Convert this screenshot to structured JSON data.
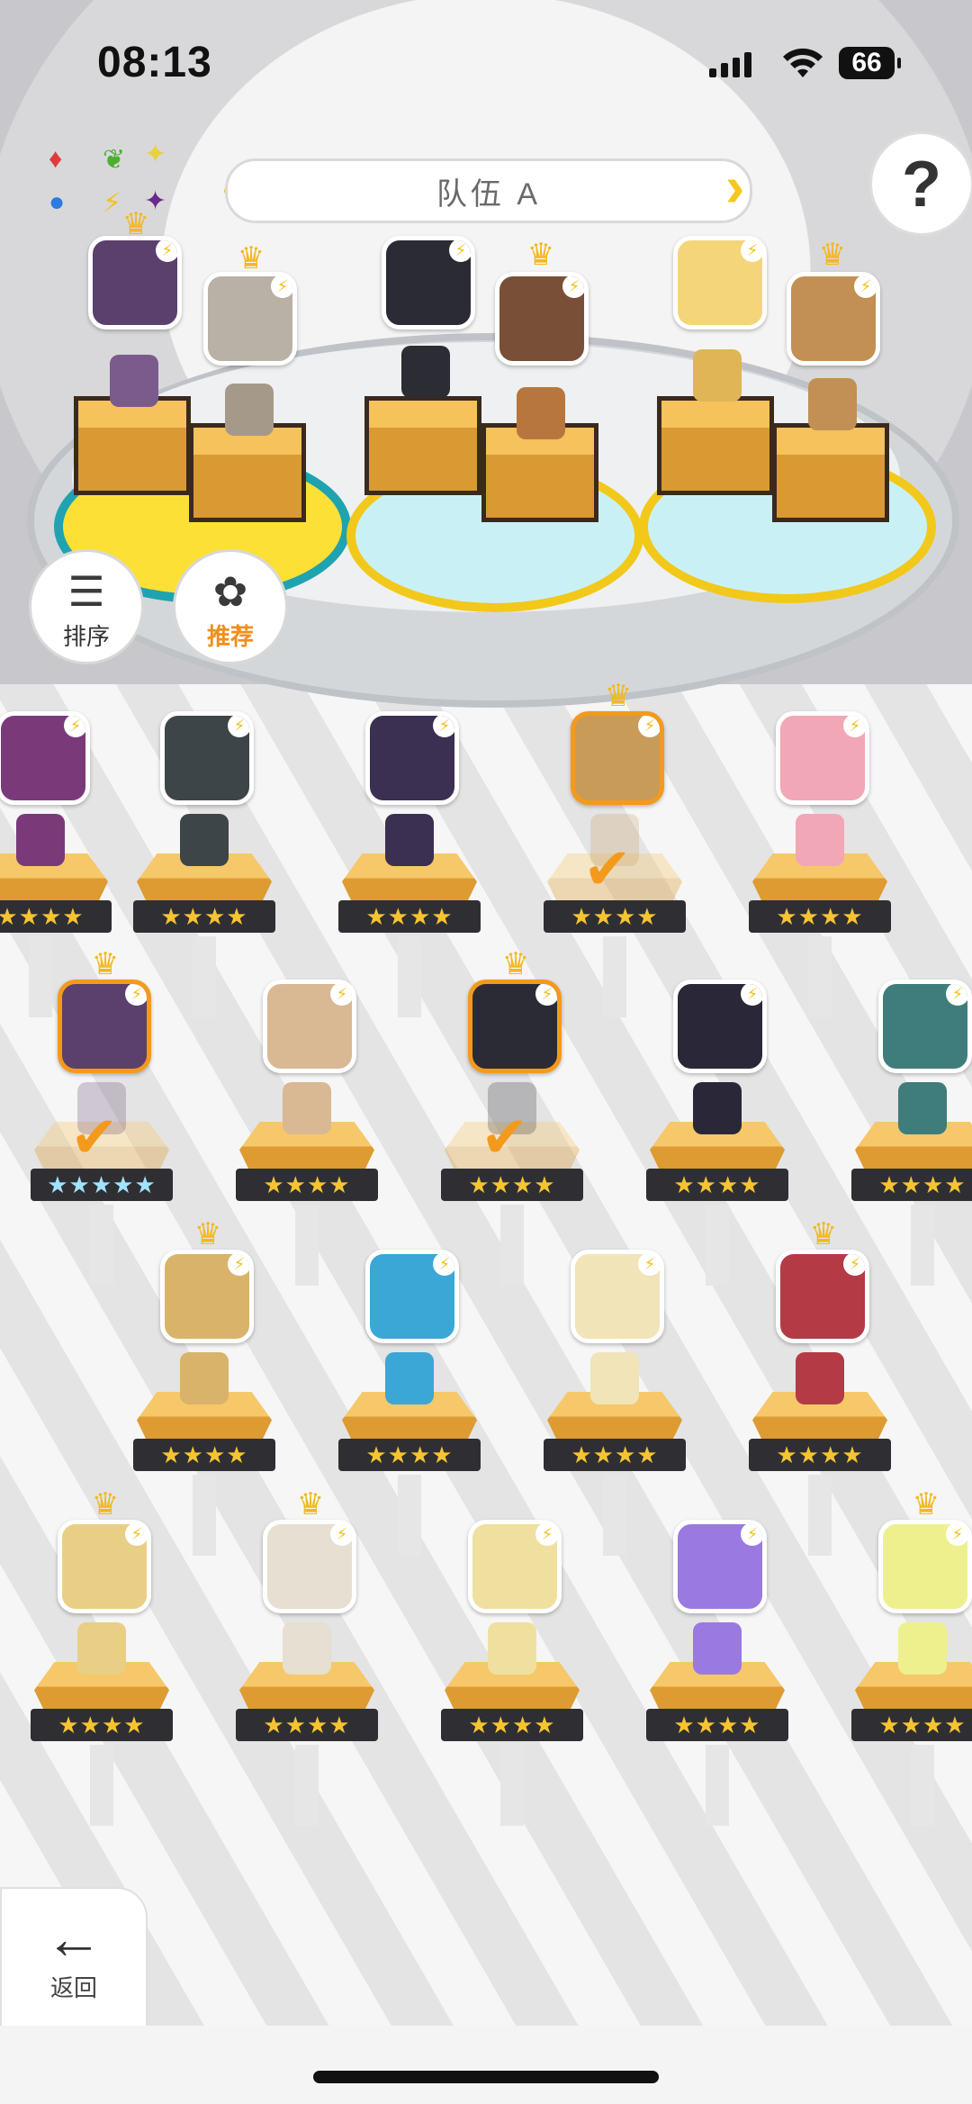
{
  "status_bar": {
    "time": "08:13",
    "battery": "66"
  },
  "header": {
    "team_title": "队伍 A",
    "help_label": "?"
  },
  "elements_legend": [
    "fire",
    "nature",
    "light",
    "water",
    "thunder",
    "dark"
  ],
  "side_buttons": {
    "sort_label": "排序",
    "recommend_label": "推荐"
  },
  "nav": {
    "back_label": "返回"
  },
  "stars": {
    "four": "★★★★",
    "five": "★★★★★"
  },
  "team_slots": [
    {
      "portrait_color": "#5b3f6c"
    },
    {
      "portrait_color": "#b9b0a6"
    },
    {
      "portrait_color": "#2b2b35"
    },
    {
      "portrait_color": "#7a4f38"
    },
    {
      "portrait_color": "#f4d57a"
    },
    {
      "portrait_color": "#c28f54"
    }
  ],
  "roster": [
    {
      "row": 0,
      "col": 0,
      "color": "#7a3a7a",
      "stars": "four",
      "selected": false,
      "crown": false
    },
    {
      "row": 0,
      "col": 1,
      "color": "#3d4548",
      "stars": "four",
      "selected": false,
      "crown": false
    },
    {
      "row": 0,
      "col": 2,
      "color": "#3b2f52",
      "stars": "four",
      "selected": false,
      "crown": false
    },
    {
      "row": 0,
      "col": 3,
      "color": "#c89b59",
      "stars": "four",
      "selected": true,
      "crown": true
    },
    {
      "row": 0,
      "col": 4,
      "color": "#f1a7b5",
      "stars": "four",
      "selected": false,
      "crown": false
    },
    {
      "row": 1,
      "col": 0,
      "color": "#5b3f6c",
      "stars": "five",
      "selected": true,
      "crown": true
    },
    {
      "row": 1,
      "col": 1,
      "color": "#d9b894",
      "stars": "four",
      "selected": false,
      "crown": false
    },
    {
      "row": 1,
      "col": 2,
      "color": "#2b2b35",
      "stars": "four",
      "selected": true,
      "crown": true
    },
    {
      "row": 1,
      "col": 3,
      "color": "#2a2838",
      "stars": "four",
      "selected": false,
      "crown": false
    },
    {
      "row": 1,
      "col": 4,
      "color": "#3f7c7c",
      "stars": "four",
      "selected": false,
      "crown": false
    },
    {
      "row": 2,
      "col": 0,
      "color": "#d9b36a",
      "stars": "four",
      "selected": false,
      "crown": true
    },
    {
      "row": 2,
      "col": 1,
      "color": "#3aa7d6",
      "stars": "four",
      "selected": false,
      "crown": false
    },
    {
      "row": 2,
      "col": 2,
      "color": "#f1e4b8",
      "stars": "four",
      "selected": false,
      "crown": false
    },
    {
      "row": 2,
      "col": 3,
      "color": "#b43a46",
      "stars": "four",
      "selected": false,
      "crown": true
    },
    {
      "row": 3,
      "col": 0,
      "color": "#e9cf86",
      "stars": "four",
      "selected": false,
      "crown": true
    },
    {
      "row": 3,
      "col": 1,
      "color": "#e6dfd2",
      "stars": "four",
      "selected": false,
      "crown": true
    },
    {
      "row": 3,
      "col": 2,
      "color": "#efe0a0",
      "stars": "four",
      "selected": false,
      "crown": false
    },
    {
      "row": 3,
      "col": 3,
      "color": "#9a7ae0",
      "stars": "four",
      "selected": false,
      "crown": false
    },
    {
      "row": 3,
      "col": 4,
      "color": "#eef08e",
      "stars": "four",
      "selected": false,
      "crown": true
    }
  ]
}
